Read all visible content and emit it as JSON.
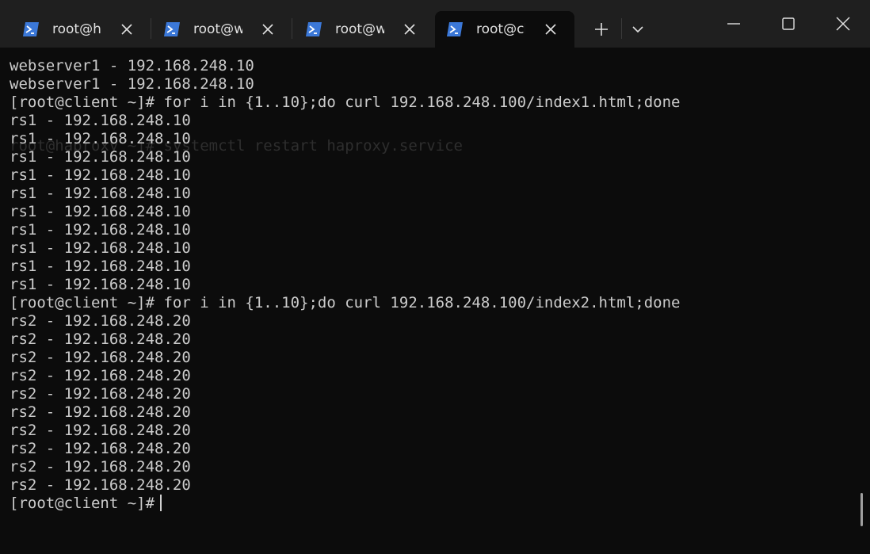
{
  "tabs": [
    {
      "label": "root@ha",
      "active": false
    },
    {
      "label": "root@w",
      "active": false
    },
    {
      "label": "root@w",
      "active": false
    },
    {
      "label": "root@cl",
      "active": true
    }
  ],
  "icons": {
    "tab": "powershell-icon",
    "close": "close-icon",
    "new_tab": "plus-icon",
    "dropdown": "chevron-down-icon",
    "minimize": "minimize-icon",
    "maximize": "maximize-icon",
    "window_close": "window-close-icon"
  },
  "colors": {
    "terminal_bg": "#0c0c0c",
    "tabbar_bg": "#1f1f1f",
    "text": "#cccccc",
    "tab_icon_blue": "#3b78d8"
  },
  "terminal": {
    "ghost_text": "root@haproxy ~]# systemctl restart haproxy.service",
    "lines": [
      "webserver1 - 192.168.248.10",
      "webserver1 - 192.168.248.10",
      "[root@client ~]# for i in {1..10};do curl 192.168.248.100/index1.html;done",
      "rs1 - 192.168.248.10",
      "rs1 - 192.168.248.10",
      "rs1 - 192.168.248.10",
      "rs1 - 192.168.248.10",
      "rs1 - 192.168.248.10",
      "rs1 - 192.168.248.10",
      "rs1 - 192.168.248.10",
      "rs1 - 192.168.248.10",
      "rs1 - 192.168.248.10",
      "rs1 - 192.168.248.10",
      "[root@client ~]# for i in {1..10};do curl 192.168.248.100/index2.html;done",
      "rs2 - 192.168.248.20",
      "rs2 - 192.168.248.20",
      "rs2 - 192.168.248.20",
      "rs2 - 192.168.248.20",
      "rs2 - 192.168.248.20",
      "rs2 - 192.168.248.20",
      "rs2 - 192.168.248.20",
      "rs2 - 192.168.248.20",
      "rs2 - 192.168.248.20",
      "rs2 - 192.168.248.20"
    ],
    "prompt": "[root@client ~]#"
  }
}
